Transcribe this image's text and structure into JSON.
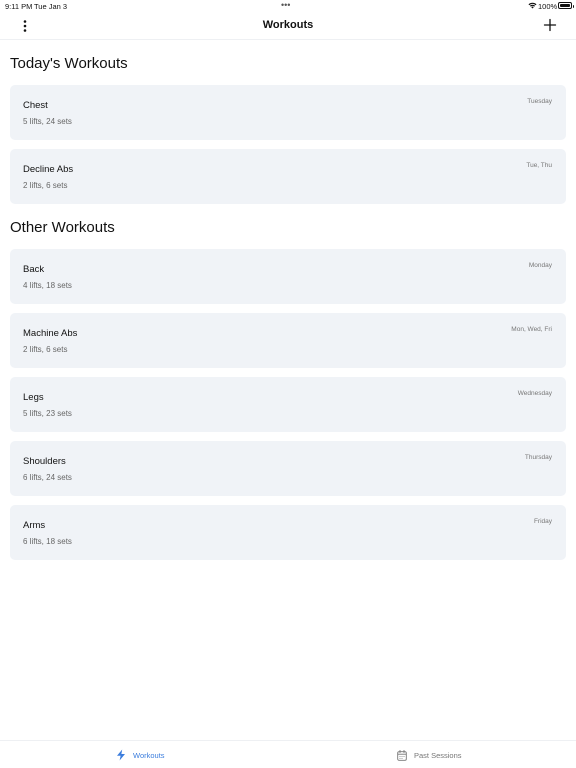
{
  "status": {
    "time": "9:11 PM",
    "date": "Tue Jan 3",
    "battery": "100%"
  },
  "nav": {
    "title": "Workouts",
    "menu_icon": "more-vertical-icon",
    "add_icon": "plus-icon"
  },
  "sections": {
    "today_title": "Today's Workouts",
    "other_title": "Other Workouts"
  },
  "today_workouts": [
    {
      "name": "Chest",
      "meta": "5 lifts, 24 sets",
      "days": "Tuesday"
    },
    {
      "name": "Decline Abs",
      "meta": "2 lifts, 6 sets",
      "days": "Tue, Thu"
    }
  ],
  "other_workouts": [
    {
      "name": "Back",
      "meta": "4 lifts, 18 sets",
      "days": "Monday"
    },
    {
      "name": "Machine Abs",
      "meta": "2 lifts, 6 sets",
      "days": "Mon, Wed, Fri"
    },
    {
      "name": "Legs",
      "meta": "5 lifts, 23 sets",
      "days": "Wednesday"
    },
    {
      "name": "Shoulders",
      "meta": "6 lifts, 24 sets",
      "days": "Thursday"
    },
    {
      "name": "Arms",
      "meta": "6 lifts, 18 sets",
      "days": "Friday"
    }
  ],
  "tabs": [
    {
      "label": "Workouts",
      "icon": "lightning-icon",
      "active": true
    },
    {
      "label": "Past Sessions",
      "icon": "calendar-icon",
      "active": false
    }
  ],
  "colors": {
    "accent": "#3b7ddd",
    "card_bg": "#f0f3f7"
  }
}
